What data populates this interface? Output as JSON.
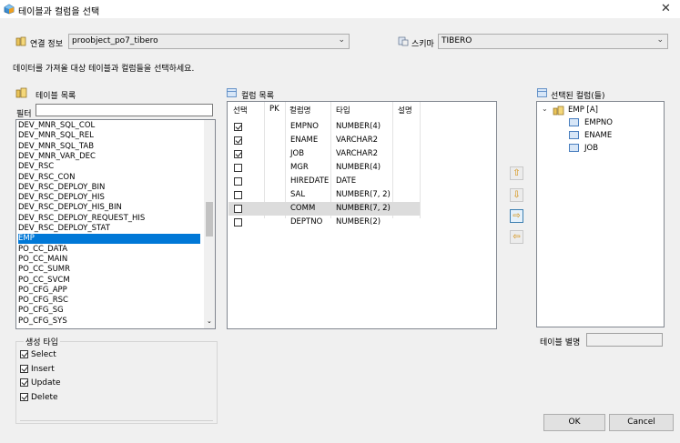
{
  "window": {
    "title": "테이블과 컬럼을 선택",
    "close_glyph": "✕"
  },
  "connection": {
    "label": "연결 정보",
    "value": "proobject_po7_tibero"
  },
  "schema": {
    "label": "스키마",
    "value": "TIBERO"
  },
  "description": "데이터를 가져올 대상 테이블과 컬럼들을 선택하세요.",
  "table_list": {
    "title": "테이블 목록",
    "filter_label": "필터",
    "filter_value": "",
    "items": [
      "DEV_MNR_SQL_COL",
      "DEV_MNR_SQL_REL",
      "DEV_MNR_SQL_TAB",
      "DEV_MNR_VAR_DEC",
      "DEV_RSC",
      "DEV_RSC_CON",
      "DEV_RSC_DEPLOY_BIN",
      "DEV_RSC_DEPLOY_HIS",
      "DEV_RSC_DEPLOY_HIS_BIN",
      "DEV_RSC_DEPLOY_REQUEST_HIS",
      "DEV_RSC_DEPLOY_STAT",
      "EMP",
      "PO_CC_DATA",
      "PO_CC_MAIN",
      "PO_CC_SUMR",
      "PO_CC_SVCM",
      "PO_CFG_APP",
      "PO_CFG_RSC",
      "PO_CFG_SG",
      "PO_CFG_SYS"
    ],
    "selected": "EMP"
  },
  "column_list": {
    "title": "컬럼 목록",
    "headers": {
      "select": "선택",
      "pk": "PK",
      "name": "컬럼명",
      "type": "타입",
      "desc": "설명"
    },
    "rows": [
      {
        "checked": true,
        "name": "EMPNO",
        "type": "NUMBER(4)"
      },
      {
        "checked": true,
        "name": "ENAME",
        "type": "VARCHAR2"
      },
      {
        "checked": true,
        "name": "JOB",
        "type": "VARCHAR2"
      },
      {
        "checked": false,
        "name": "MGR",
        "type": "NUMBER(4)"
      },
      {
        "checked": false,
        "name": "HIREDATE",
        "type": "DATE"
      },
      {
        "checked": false,
        "name": "SAL",
        "type": "NUMBER(7, 2)"
      },
      {
        "checked": false,
        "name": "COMM",
        "type": "NUMBER(7, 2)"
      },
      {
        "checked": false,
        "name": "DEPTNO",
        "type": "NUMBER(2)"
      }
    ],
    "highlighted_row": "COMM"
  },
  "selected_columns": {
    "title": "선택된 컬럼(들)",
    "root": "EMP [A]",
    "children": [
      "EMPNO",
      "ENAME",
      "JOB"
    ]
  },
  "alias": {
    "label": "테이블 별명",
    "value": ""
  },
  "gen_type": {
    "title": "생성 타입",
    "options": [
      {
        "label": "Select",
        "checked": true
      },
      {
        "label": "Insert",
        "checked": true
      },
      {
        "label": "Update",
        "checked": true
      },
      {
        "label": "Delete",
        "checked": true
      }
    ]
  },
  "buttons": {
    "ok": "OK",
    "cancel": "Cancel",
    "up": "⇧",
    "down": "⇩",
    "add": "⇨",
    "remove": "⇦"
  },
  "colors": {
    "accent": "#0078d7",
    "row_highlight": "#dcdcdc",
    "arrow": "#d38a00"
  }
}
